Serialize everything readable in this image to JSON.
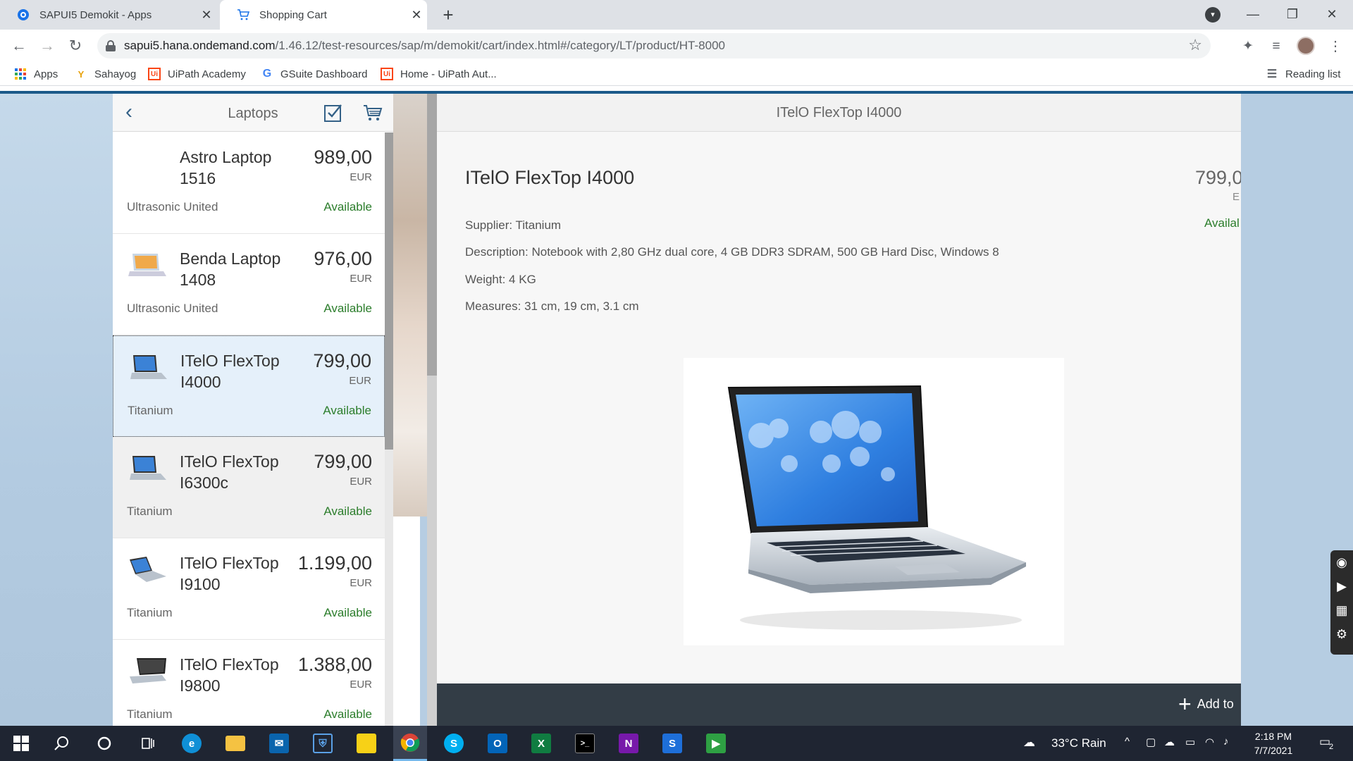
{
  "browser": {
    "tabs": [
      {
        "title": "SAPUI5 Demokit - Apps"
      },
      {
        "title": "Shopping Cart"
      }
    ],
    "url": {
      "host": "sapui5.hana.ondemand.com",
      "path": "/1.46.12/test-resources/sap/m/demokit/cart/index.html#/category/LT/product/HT-8000"
    },
    "bookmarks": [
      {
        "label": "Apps"
      },
      {
        "label": "Sahayog"
      },
      {
        "label": "UiPath Academy"
      },
      {
        "label": "GSuite Dashboard"
      },
      {
        "label": "Home - UiPath Aut..."
      }
    ],
    "reading_list": "Reading list"
  },
  "master": {
    "title": "Laptops",
    "items": [
      {
        "name": "Astro Laptop 1516",
        "price": "989,00",
        "currency": "EUR",
        "supplier": "Ultrasonic United",
        "status": "Available"
      },
      {
        "name": "Benda Laptop 1408",
        "price": "976,00",
        "currency": "EUR",
        "supplier": "Ultrasonic United",
        "status": "Available"
      },
      {
        "name": "ITelO FlexTop I4000",
        "price": "799,00",
        "currency": "EUR",
        "supplier": "Titanium",
        "status": "Available"
      },
      {
        "name": "ITelO FlexTop I6300c",
        "price": "799,00",
        "currency": "EUR",
        "supplier": "Titanium",
        "status": "Available"
      },
      {
        "name": "ITelO FlexTop I9100",
        "price": "1.199,00",
        "currency": "EUR",
        "supplier": "Titanium",
        "status": "Available"
      },
      {
        "name": "ITelO FlexTop I9800",
        "price": "1.388,00",
        "currency": "EUR",
        "supplier": "Titanium",
        "status": "Available"
      }
    ]
  },
  "detail": {
    "header_title": "ITelO FlexTop I4000",
    "name": "ITelO FlexTop I4000",
    "price": "799,0",
    "currency": "E",
    "status": "Availal",
    "supplier": "Supplier: Titanium",
    "description": "Description: Notebook with 2,80 GHz dual core, 4 GB DDR3 SDRAM, 500 GB Hard Disc, Windows 8",
    "weight": "Weight: 4 KG",
    "measures": "Measures: 31 cm, 19 cm, 3.1 cm",
    "add_button": "Add to"
  },
  "taskbar": {
    "weather": "33°C  Rain",
    "time": "2:18 PM",
    "date": "7/7/2021",
    "notifications": "2"
  }
}
